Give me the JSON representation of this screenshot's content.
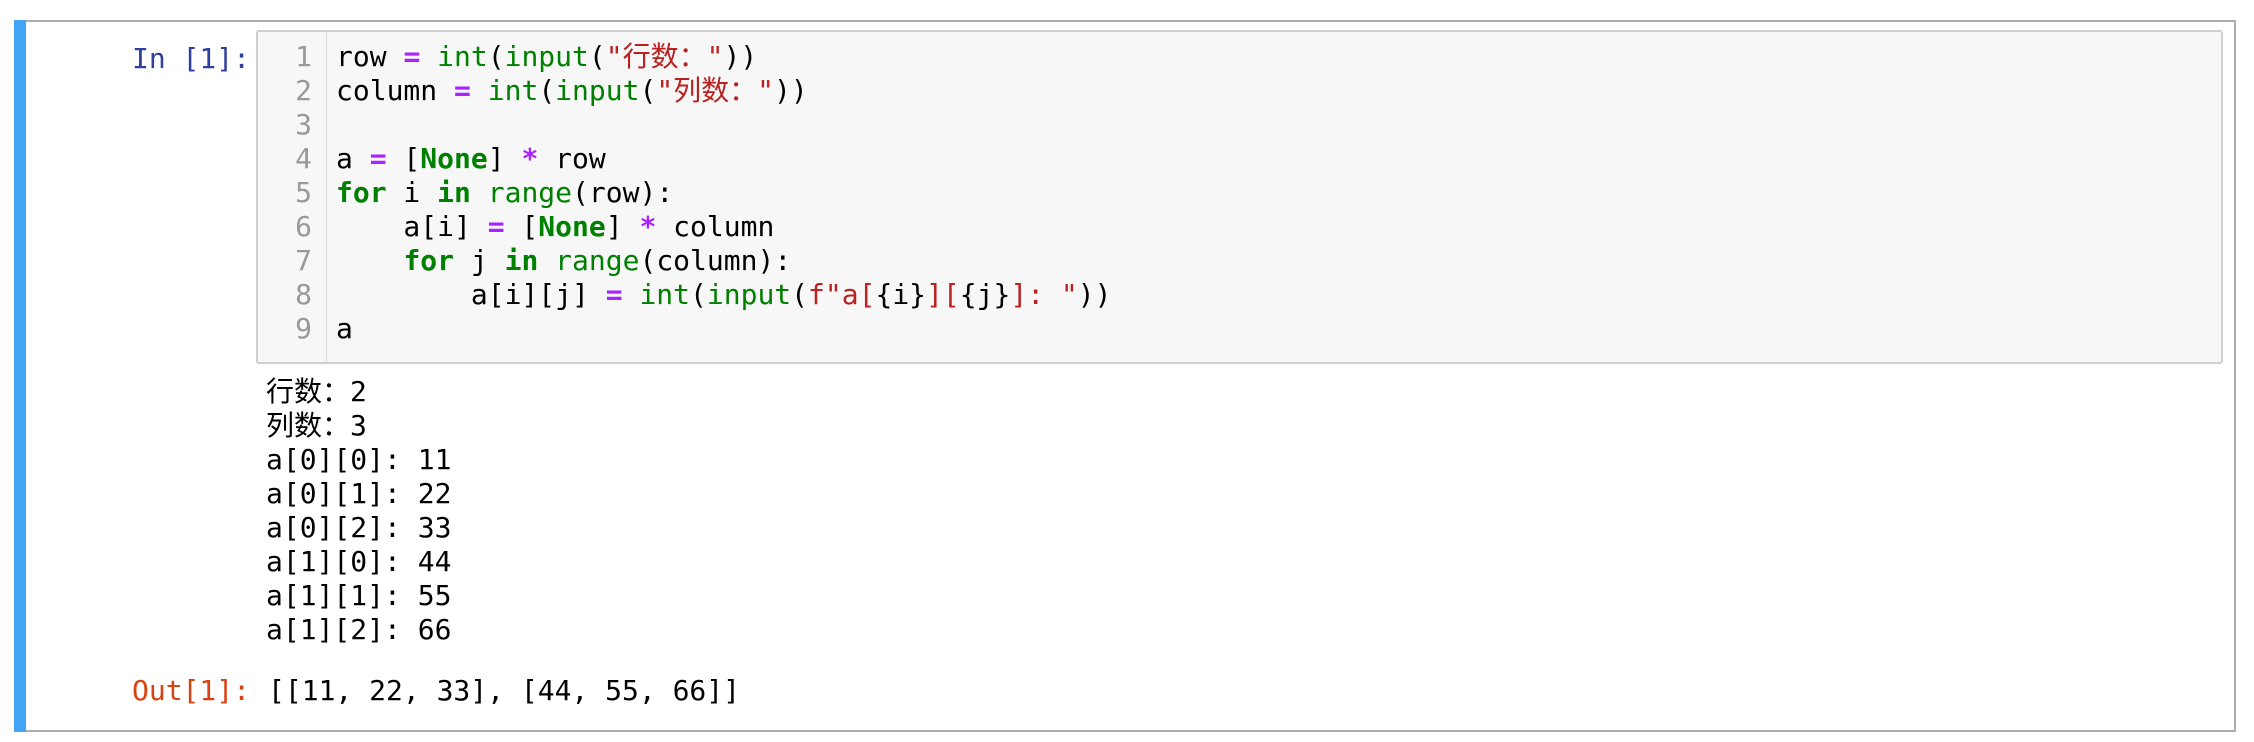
{
  "notebook": {
    "accent_color": "#42a5f5",
    "input_prompt": "In [1]:",
    "output_prompt": "Out[1]:",
    "code_lines": [
      {
        "num": "1",
        "tokens": [
          {
            "t": "row ",
            "c": ""
          },
          {
            "t": "=",
            "c": "op"
          },
          {
            "t": " ",
            "c": ""
          },
          {
            "t": "int",
            "c": "bi"
          },
          {
            "t": "(",
            "c": ""
          },
          {
            "t": "input",
            "c": "bi"
          },
          {
            "t": "(",
            "c": ""
          },
          {
            "t": "\"行数：\"",
            "c": "str"
          },
          {
            "t": "))",
            "c": ""
          }
        ]
      },
      {
        "num": "2",
        "tokens": [
          {
            "t": "column ",
            "c": ""
          },
          {
            "t": "=",
            "c": "op"
          },
          {
            "t": " ",
            "c": ""
          },
          {
            "t": "int",
            "c": "bi"
          },
          {
            "t": "(",
            "c": ""
          },
          {
            "t": "input",
            "c": "bi"
          },
          {
            "t": "(",
            "c": ""
          },
          {
            "t": "\"列数：\"",
            "c": "str"
          },
          {
            "t": "))",
            "c": ""
          }
        ]
      },
      {
        "num": "3",
        "tokens": []
      },
      {
        "num": "4",
        "tokens": [
          {
            "t": "a ",
            "c": ""
          },
          {
            "t": "=",
            "c": "op"
          },
          {
            "t": " [",
            "c": ""
          },
          {
            "t": "None",
            "c": "kw"
          },
          {
            "t": "] ",
            "c": ""
          },
          {
            "t": "*",
            "c": "op"
          },
          {
            "t": " row",
            "c": ""
          }
        ]
      },
      {
        "num": "5",
        "tokens": [
          {
            "t": "for",
            "c": "kw"
          },
          {
            "t": " i ",
            "c": ""
          },
          {
            "t": "in",
            "c": "kw"
          },
          {
            "t": " ",
            "c": ""
          },
          {
            "t": "range",
            "c": "bi"
          },
          {
            "t": "(row):",
            "c": ""
          }
        ]
      },
      {
        "num": "6",
        "tokens": [
          {
            "t": "    a[i] ",
            "c": ""
          },
          {
            "t": "=",
            "c": "op"
          },
          {
            "t": " [",
            "c": ""
          },
          {
            "t": "None",
            "c": "kw"
          },
          {
            "t": "] ",
            "c": ""
          },
          {
            "t": "*",
            "c": "op"
          },
          {
            "t": " column",
            "c": ""
          }
        ]
      },
      {
        "num": "7",
        "tokens": [
          {
            "t": "    ",
            "c": ""
          },
          {
            "t": "for",
            "c": "kw"
          },
          {
            "t": " j ",
            "c": ""
          },
          {
            "t": "in",
            "c": "kw"
          },
          {
            "t": " ",
            "c": ""
          },
          {
            "t": "range",
            "c": "bi"
          },
          {
            "t": "(column):",
            "c": ""
          }
        ]
      },
      {
        "num": "8",
        "tokens": [
          {
            "t": "        a[i][j] ",
            "c": ""
          },
          {
            "t": "=",
            "c": "op"
          },
          {
            "t": " ",
            "c": ""
          },
          {
            "t": "int",
            "c": "bi"
          },
          {
            "t": "(",
            "c": ""
          },
          {
            "t": "input",
            "c": "bi"
          },
          {
            "t": "(",
            "c": ""
          },
          {
            "t": "f\"a[",
            "c": "str"
          },
          {
            "t": "{i}",
            "c": ""
          },
          {
            "t": "][",
            "c": "str"
          },
          {
            "t": "{j}",
            "c": ""
          },
          {
            "t": "]: \"",
            "c": "str"
          },
          {
            "t": "))",
            "c": ""
          }
        ]
      },
      {
        "num": "9",
        "tokens": [
          {
            "t": "a",
            "c": ""
          }
        ]
      }
    ],
    "stdout_lines": [
      "行数：2",
      "列数：3",
      "a[0][0]: 11",
      "a[0][1]: 22",
      "a[0][2]: 33",
      "a[1][0]: 44",
      "a[1][1]: 55",
      "a[1][2]: 66"
    ],
    "output_result": "[[11, 22, 33], [44, 55, 66]]"
  }
}
